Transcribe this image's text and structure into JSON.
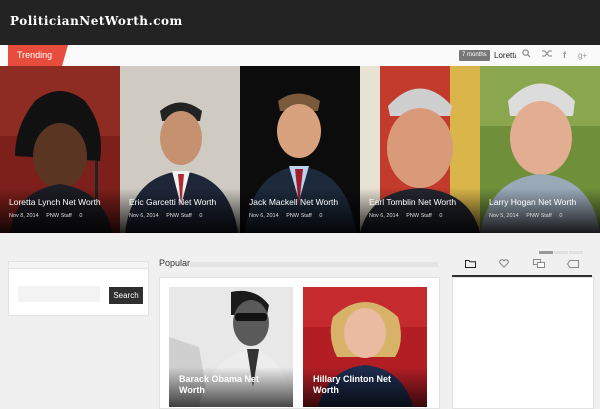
{
  "site": {
    "logo": "PoliticianNetWorth.com"
  },
  "trending": {
    "label": "Trending",
    "badge": "7 months",
    "item": "Loretta",
    "icons": [
      "search-icon",
      "shuffle-icon",
      "facebook-icon",
      "google-plus-icon"
    ]
  },
  "slider": {
    "slides": [
      {
        "title": "Loretta Lynch Net Worth",
        "date": "Nov 8, 2014",
        "author": "PNW Staff",
        "comments": "0"
      },
      {
        "title": "Eric Garcetti Net Worth",
        "date": "Nov 6, 2014",
        "author": "PNW Staff",
        "comments": "0"
      },
      {
        "title": "Jack Mackell Net Worth",
        "date": "Nov 6, 2014",
        "author": "PNW Staff",
        "comments": "0"
      },
      {
        "title": "Earl Tomblin Net Worth",
        "date": "Nov 6, 2014",
        "author": "PNW Staff",
        "comments": "0"
      },
      {
        "title": "Larry Hogan Net Worth",
        "date": "Nov 5, 2014",
        "author": "PNW Staff",
        "comments": "0"
      }
    ]
  },
  "search": {
    "button": "Search",
    "placeholder": ""
  },
  "popular": {
    "heading": "Popular",
    "items": [
      {
        "title": "Barack Obama Net Worth"
      },
      {
        "title": "Hillary Clinton Net Worth"
      }
    ]
  },
  "sidebar_tabs": [
    "folder-icon",
    "heart-icon",
    "comments-icon",
    "tag-icon"
  ]
}
